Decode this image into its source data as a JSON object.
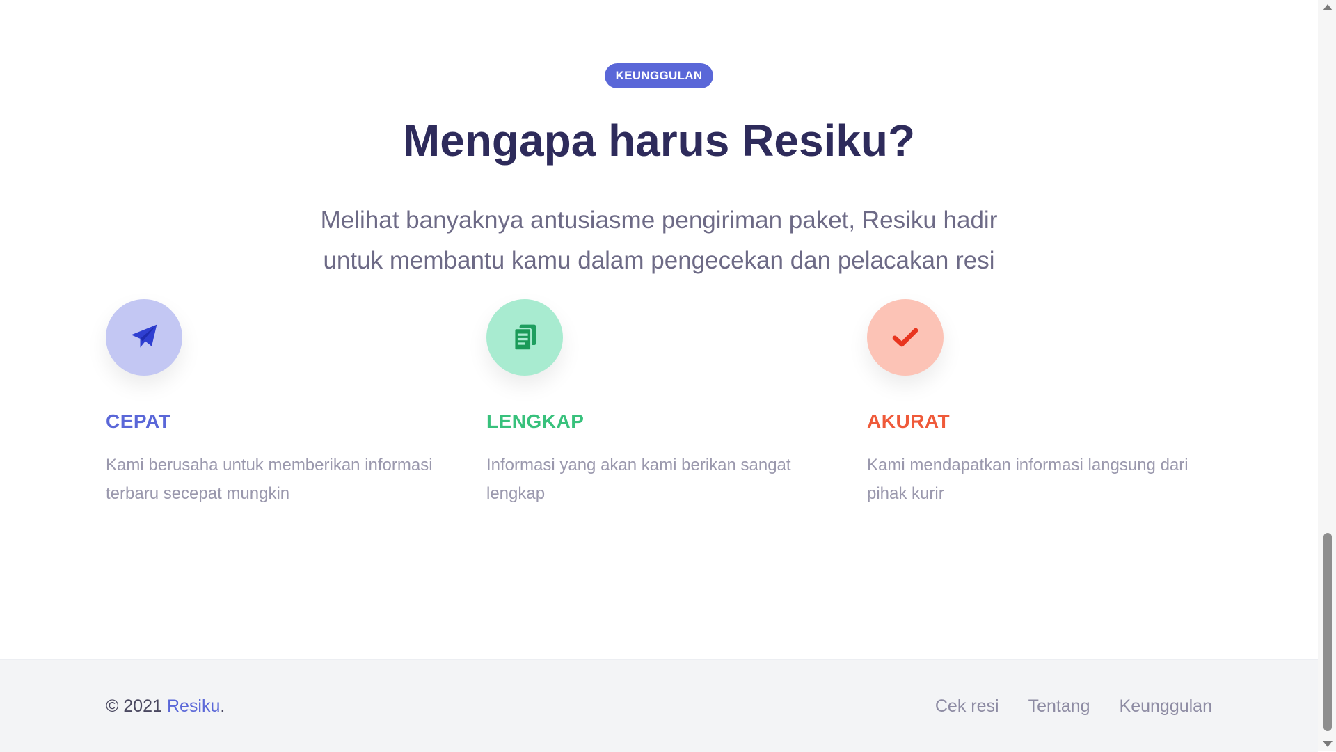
{
  "section": {
    "badge": "KEUNGGULAN",
    "title": "Mengapa harus Resiku?",
    "subtitle": "Melihat banyaknya antusiasme pengiriman paket, Resiku hadir untuk membantu kamu dalam pengecekan dan pelacakan resi"
  },
  "features": [
    {
      "icon": "paper-plane-icon",
      "title": "CEPAT",
      "description": "Kami berusaha untuk memberikan informasi terbaru secepat mungkin",
      "color": "#5a67d8"
    },
    {
      "icon": "document-icon",
      "title": "LENGKAP",
      "description": "Informasi yang akan kami berikan sangat lengkap",
      "color": "#38c17c"
    },
    {
      "icon": "check-icon",
      "title": "AKURAT",
      "description": "Kami mendapatkan informasi langsung dari pihak kurir",
      "color": "#ef5a3a"
    }
  ],
  "footer": {
    "copyright_prefix": "© 2021",
    "brand": "Resiku",
    "copyright_suffix": ".",
    "nav": [
      "Cek resi",
      "Tentang",
      "Keunggulan"
    ]
  },
  "colors": {
    "accent": "#5a67d8",
    "title": "#2e2b5b",
    "footer_bg": "#f3f4f6"
  }
}
